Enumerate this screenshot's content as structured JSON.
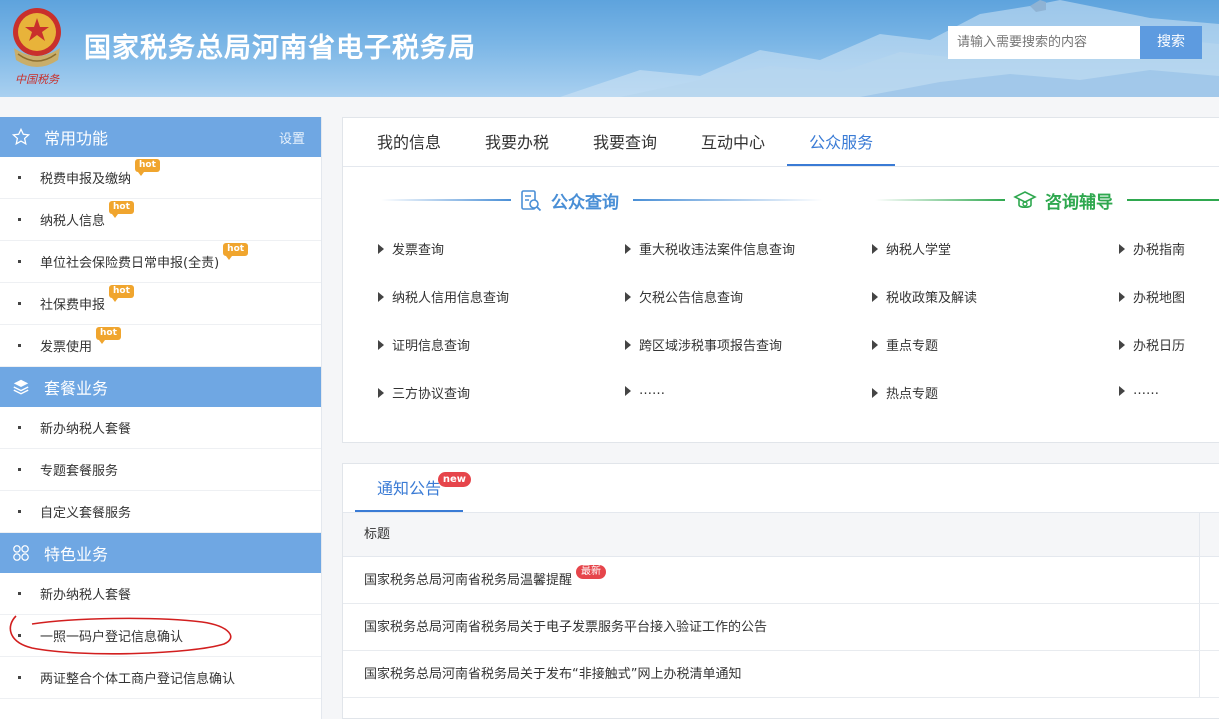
{
  "header": {
    "title": "国家税务总局河南省电子税务局",
    "logo_caption": "中国税务",
    "search_placeholder": "请输入需要搜索的内容",
    "search_button": "搜索"
  },
  "sidebar": {
    "sections": [
      {
        "title": "常用功能",
        "icon": "star-icon",
        "setting": "设置",
        "items": [
          {
            "label": "税费申报及缴纳",
            "hot": "hot"
          },
          {
            "label": "纳税人信息",
            "hot": "hot"
          },
          {
            "label": "单位社会保险费日常申报(全责)",
            "hot": "hot"
          },
          {
            "label": "社保费申报",
            "hot": "hot"
          },
          {
            "label": "发票使用",
            "hot": "hot"
          }
        ]
      },
      {
        "title": "套餐业务",
        "icon": "layers-icon",
        "items": [
          {
            "label": "新办纳税人套餐"
          },
          {
            "label": "专题套餐服务"
          },
          {
            "label": "自定义套餐服务"
          }
        ]
      },
      {
        "title": "特色业务",
        "icon": "grid-icon",
        "items": [
          {
            "label": "新办纳税人套餐"
          },
          {
            "label": "一照一码户登记信息确认"
          },
          {
            "label": "两证整合个体工商户登记信息确认"
          }
        ]
      }
    ]
  },
  "services": {
    "tabs": [
      "我的信息",
      "我要办税",
      "我要查询",
      "互动中心",
      "公众服务"
    ],
    "active_tab": 4,
    "category_left": "公众查询",
    "category_right": "咨询辅导",
    "columns": [
      [
        "发票查询",
        "纳税人信用信息查询",
        "证明信息查询",
        "三方协议查询"
      ],
      [
        "重大税收违法案件信息查询",
        "欠税公告信息查询",
        "跨区域涉税事项报告查询",
        "……"
      ],
      [
        "纳税人学堂",
        "税收政策及解读",
        "重点专题",
        "热点专题"
      ],
      [
        "办税指南",
        "办税地图",
        "办税日历",
        "……"
      ]
    ]
  },
  "notices": {
    "tab": "通知公告",
    "tab_badge": "new",
    "header": "标题",
    "rows": [
      {
        "title": "国家税务总局河南省税务局温馨提醒",
        "badge": "最新"
      },
      {
        "title": "国家税务总局河南省税务局关于电子发票服务平台接入验证工作的公告"
      },
      {
        "title": "国家税务总局河南省税务局关于发布“非接触式”网上办税清单通知"
      }
    ]
  },
  "colors": {
    "accent": "#3a7bd5",
    "sidebar_header": "#6fa7e3",
    "hot_badge": "#f0a52e",
    "new_badge": "#e6454b",
    "consult_green": "#2fa84f",
    "query_blue": "#4a8fd6"
  }
}
